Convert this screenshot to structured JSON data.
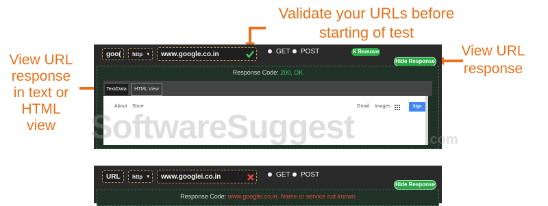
{
  "annotations": {
    "validate_line1": "Validate your URLs before",
    "validate_line2": "starting of test",
    "view_left_lines": [
      "View URL",
      "response",
      "in text or",
      "HTML",
      "view"
    ],
    "view_right_lines": [
      "View URL",
      "response"
    ],
    "accent_color": "#e8711b"
  },
  "panel1": {
    "label_field": "goo(",
    "protocol": "http",
    "url_value": "www.google.co.in",
    "valid_icon": "green-check-icon",
    "method_get": "GET",
    "method_post": "POST",
    "remove_label": "X Remove",
    "hide_response_label": "Hide Response",
    "response_prefix": "Response Code:",
    "response_value": "200, OK",
    "tabs": [
      "Text/Data",
      "HTML View"
    ],
    "webview": {
      "nav_left": [
        "About",
        "Store"
      ],
      "nav_right": [
        "Gmail",
        "Images"
      ],
      "apps_icon": "apps-grid-icon",
      "sign_in": "Sign"
    }
  },
  "panel2": {
    "label_field": "URL",
    "protocol": "http",
    "url_value": "www.googlei.co.in",
    "invalid_icon": "red-x-icon",
    "method_get": "GET",
    "method_post": "POST",
    "hide_response_label": "Hide Response",
    "response_prefix": "Response Code:",
    "response_value": "www.googlei.co.in. Name or service not known"
  },
  "watermark": {
    "text": "SoftwareSuggest",
    "suffix": ".com"
  },
  "colors": {
    "panel_bg": "#2a2a2a",
    "success": "#3ec85a",
    "error": "#e5483a",
    "button_green": "#27a844"
  }
}
